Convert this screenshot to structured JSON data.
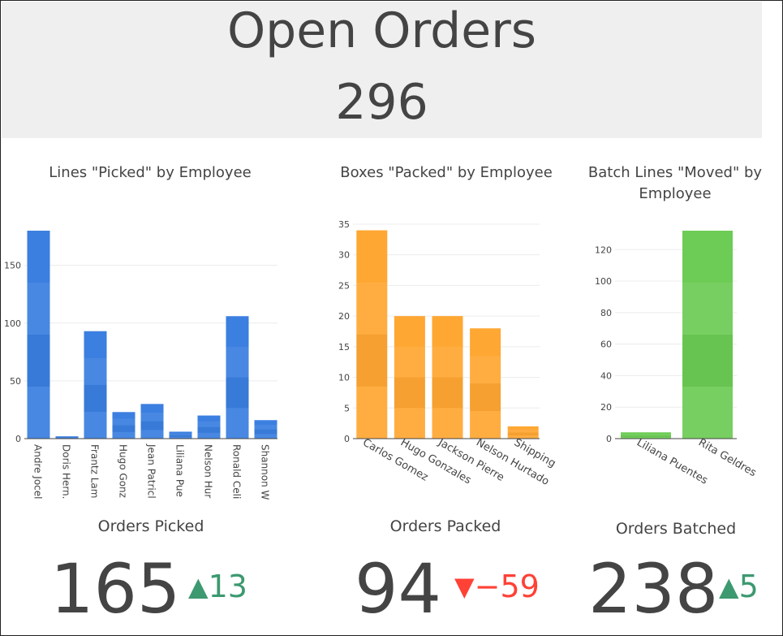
{
  "header": {
    "title": "Open Orders",
    "count": "296"
  },
  "colors": {
    "blue": "#3b7fe0",
    "orange": "#ffa733",
    "green": "#6dcc55",
    "up": "#3d9970",
    "down": "#ff4136"
  },
  "chart_data": [
    {
      "type": "bar",
      "title": "Lines \"Picked\" by Employee",
      "categories": [
        "Andre Jocel",
        "Doris Hern.",
        "Frantz Lam",
        "Hugo Gonz",
        "Jean Patricl",
        "Liliana Pue",
        "Nelson Hur",
        "Ronald Celi",
        "Shannon W"
      ],
      "values": [
        180,
        2,
        93,
        23,
        30,
        6,
        20,
        106,
        16
      ],
      "ylim": [
        0,
        180
      ],
      "yticks": [
        "0",
        "50",
        "100",
        "150"
      ],
      "color": "#3b7fe0"
    },
    {
      "type": "bar",
      "title": "Boxes \"Packed\" by Employee",
      "categories": [
        "Carlos Gomez",
        "Hugo Gonzales",
        "Jackson Pierre",
        "Nelson Hurtado",
        "Shipping"
      ],
      "values": [
        34,
        20,
        20,
        18,
        2
      ],
      "ylim": [
        0,
        35
      ],
      "yticks": [
        "0",
        "5",
        "10",
        "15",
        "20",
        "25",
        "30",
        "35"
      ],
      "color": "#ffa733"
    },
    {
      "type": "bar",
      "title": "Batch Lines \"Moved\" by Employee",
      "categories": [
        "Liliana Puentes",
        "Rita Geldres"
      ],
      "values": [
        4,
        132
      ],
      "ylim": [
        0,
        132
      ],
      "yticks": [
        "0",
        "20",
        "40",
        "60",
        "80",
        "100",
        "120"
      ],
      "color": "#6dcc55"
    }
  ],
  "kpis": [
    {
      "label": "Orders Picked",
      "value": "165",
      "delta": "13",
      "direction": "up"
    },
    {
      "label": "Orders Packed",
      "value": "94",
      "delta": "−59",
      "direction": "down"
    },
    {
      "label": "Orders Batched",
      "value": "238",
      "delta": "5",
      "direction": "up"
    }
  ],
  "arrows": {
    "up": "▲",
    "down": "▼"
  }
}
